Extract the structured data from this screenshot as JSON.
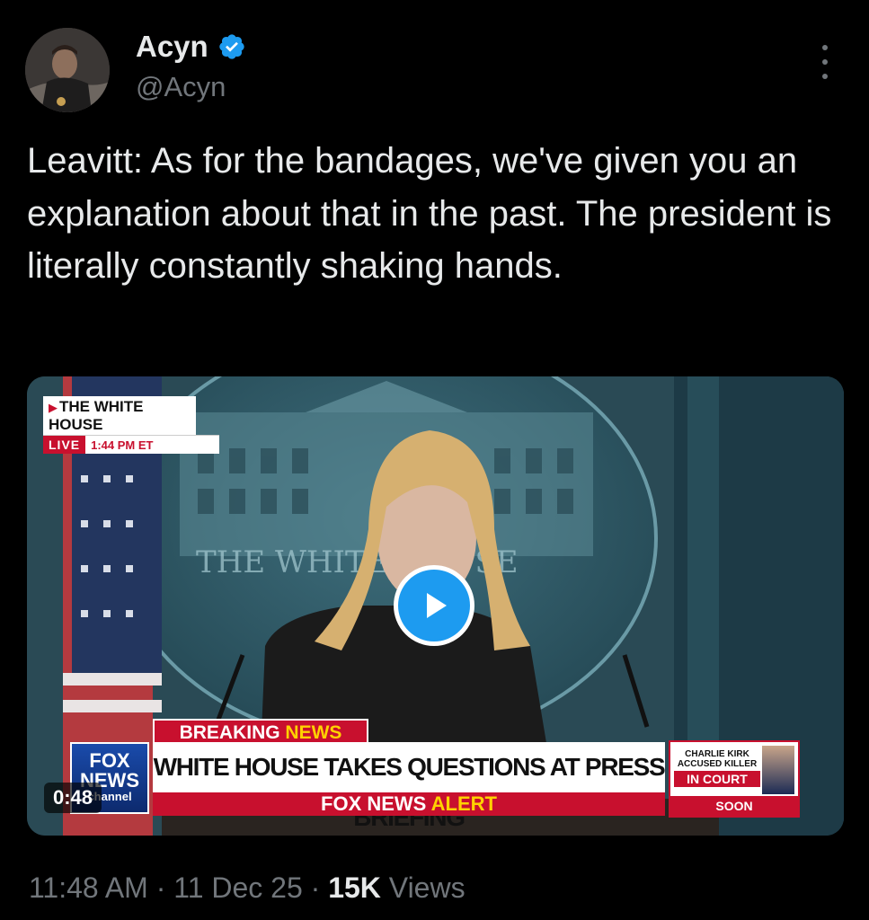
{
  "author": {
    "display_name": "Acyn",
    "handle": "@Acyn",
    "verified": true
  },
  "tweet": {
    "text": "Leavitt: As for the bandages, we've given you an explanation about that in the past. The president is literally constantly shaking hands."
  },
  "video": {
    "duration": "0:48",
    "overlay": {
      "location": "THE WHITE HOUSE",
      "live_label": "LIVE",
      "live_time": "1:44 PM ET",
      "podium_text": "THE WHITE HOUSE",
      "breaking_label": "BREAKING",
      "breaking_news": "NEWS",
      "headline": "WHITE HOUSE TAKES QUESTIONS AT PRESS BRIEFING",
      "alert_brand": "FOX NEWS",
      "alert_word": "ALERT",
      "network_logo_line1": "FOX",
      "network_logo_line2": "NEWS",
      "network_logo_line3": "channel",
      "promo_top": "CHARLIE KIRK ACCUSED KILLER",
      "promo_middle": "IN COURT",
      "promo_bottom": "SOON"
    }
  },
  "meta": {
    "time": "11:48 AM",
    "separator": "·",
    "date": "11 Dec 25",
    "views_count": "15K",
    "views_label": "Views"
  },
  "colors": {
    "background": "#000000",
    "text": "#e7e9ea",
    "secondary_text": "#71767b",
    "accent_blue": "#1d9bf0",
    "fox_red": "#c8102e",
    "fox_yellow": "#ffd200"
  },
  "icons": {
    "verified": "verified-badge-icon",
    "more": "more-options-icon",
    "play": "play-icon"
  }
}
